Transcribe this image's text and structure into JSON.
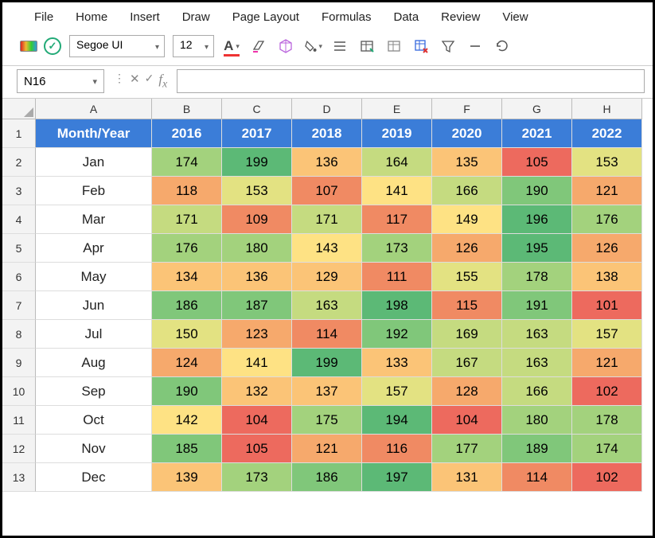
{
  "menu": [
    "File",
    "Home",
    "Insert",
    "Draw",
    "Page Layout",
    "Formulas",
    "Data",
    "Review",
    "View"
  ],
  "toolbar": {
    "font": "Segoe UI",
    "size": "12"
  },
  "namebox": "N16",
  "formula": "",
  "columns": [
    "A",
    "B",
    "C",
    "D",
    "E",
    "F",
    "G",
    "H"
  ],
  "chart_data": {
    "type": "heatmap",
    "title": "Month/Year",
    "categories_x": [
      "2016",
      "2017",
      "2018",
      "2019",
      "2020",
      "2021",
      "2022"
    ],
    "categories_y": [
      "Jan",
      "Feb",
      "Mar",
      "Apr",
      "May",
      "Jun",
      "Jul",
      "Aug",
      "Sep",
      "Oct",
      "Nov",
      "Dec"
    ],
    "values": [
      [
        174,
        199,
        136,
        164,
        135,
        105,
        153
      ],
      [
        118,
        153,
        107,
        141,
        166,
        190,
        121
      ],
      [
        171,
        109,
        171,
        117,
        149,
        196,
        176
      ],
      [
        176,
        180,
        143,
        173,
        126,
        195,
        126
      ],
      [
        134,
        136,
        129,
        111,
        155,
        178,
        138
      ],
      [
        186,
        187,
        163,
        198,
        115,
        191,
        101
      ],
      [
        150,
        123,
        114,
        192,
        169,
        163,
        157
      ],
      [
        124,
        141,
        199,
        133,
        167,
        163,
        121
      ],
      [
        190,
        132,
        137,
        157,
        128,
        166,
        102
      ],
      [
        142,
        104,
        175,
        194,
        104,
        180,
        178
      ],
      [
        185,
        105,
        121,
        116,
        177,
        189,
        174
      ],
      [
        139,
        173,
        186,
        197,
        131,
        114,
        102
      ]
    ],
    "value_range": [
      101,
      199
    ]
  }
}
